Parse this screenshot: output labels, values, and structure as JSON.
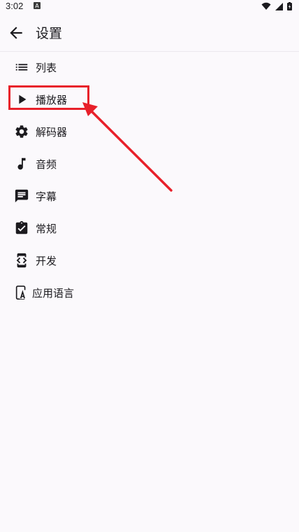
{
  "status_bar": {
    "time": "3:02"
  },
  "app_bar": {
    "title": "设置"
  },
  "menu": {
    "items": [
      {
        "label": "列表",
        "icon": "list-icon"
      },
      {
        "label": "播放器",
        "icon": "play-icon"
      },
      {
        "label": "解码器",
        "icon": "gear-icon"
      },
      {
        "label": "音频",
        "icon": "music-note-icon"
      },
      {
        "label": "字幕",
        "icon": "subtitles-icon"
      },
      {
        "label": "常规",
        "icon": "clipboard-check-icon"
      },
      {
        "label": "开发",
        "icon": "developer-mode-icon"
      },
      {
        "label": "应用语言",
        "icon": "phone-language-icon"
      }
    ]
  },
  "annotation": {
    "color": "#e8202a"
  },
  "colors": {
    "icon": "#1c1b1f",
    "background": "#fbf9fc"
  }
}
